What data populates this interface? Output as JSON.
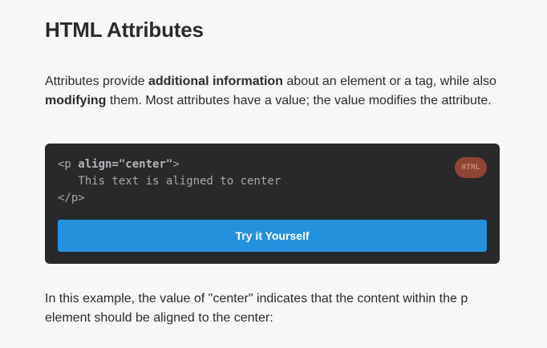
{
  "page": {
    "title": "HTML Attributes"
  },
  "intro": {
    "part1": "Attributes provide ",
    "bold1": "additional information",
    "part2": " about an element or a tag, while also ",
    "bold2": "modifying",
    "part3": " them. Most attributes have a value; the value modifies the attribute."
  },
  "code_example": {
    "line1_open": "<p ",
    "line1_attr": "align=\"center\"",
    "line1_close": ">",
    "line2": "   This text is aligned to center",
    "line3": "</p>",
    "language_badge": "HTML",
    "try_button_label": "Try it Yourself"
  },
  "explanation": {
    "text": "In this example, the value of \"center\" indicates that the content within the p element should be aligned to the center:"
  },
  "colors": {
    "background": "#f7f7f8",
    "code_background": "#29292b",
    "button_accent": "#2491dd",
    "badge": "#8f4535"
  }
}
